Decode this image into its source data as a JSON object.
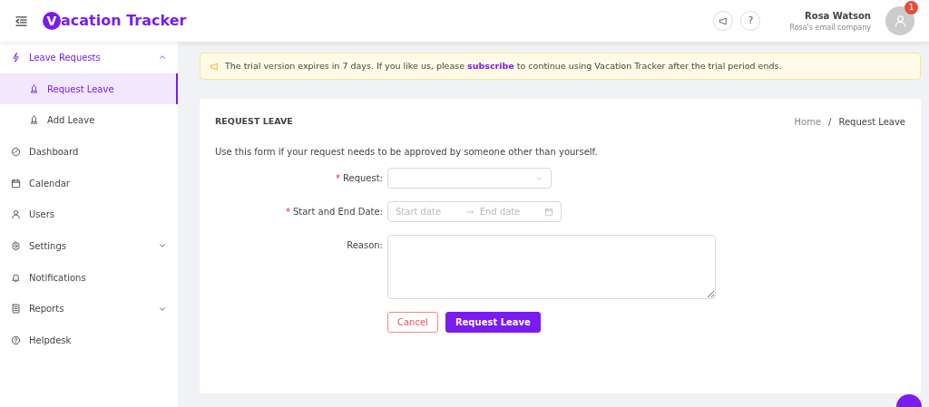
{
  "header": {
    "brand": {
      "mark": "V",
      "text": "acation Tracker"
    },
    "user": {
      "name": "Rosa Watson",
      "company": "Rosa's email company",
      "badge": "1",
      "help": "?"
    }
  },
  "sidebar": {
    "items": [
      {
        "label": "Leave Requests",
        "expanded": true,
        "selected": false,
        "children": [
          {
            "label": "Request Leave",
            "selected": true
          },
          {
            "label": "Add Leave",
            "selected": false
          }
        ]
      },
      {
        "label": "Dashboard",
        "selected": false
      },
      {
        "label": "Calendar",
        "selected": false
      },
      {
        "label": "Users",
        "selected": false
      },
      {
        "label": "Settings",
        "expanded": false,
        "selected": false
      },
      {
        "label": "Notifications",
        "selected": false
      },
      {
        "label": "Reports",
        "expanded": false,
        "selected": false
      },
      {
        "label": "Helpdesk",
        "selected": false
      }
    ]
  },
  "alert": {
    "text": "The trial version expires in 7 days. If you like us, please",
    "link": "subscribe",
    "after": "to continue using Vacation Tracker after the trial period ends."
  },
  "card": {
    "title": "REQUEST LEAVE",
    "breadcrumb": [
      "Home",
      "Request Leave"
    ],
    "breadcrumb_separator": "/",
    "intro": "Use this form if your request needs to be approved by someone other than yourself.",
    "fields": [
      {
        "kind": "select",
        "label": "Request:",
        "required_mark": "*"
      },
      {
        "kind": "daterange",
        "label": "Start and End Date:",
        "required_mark": "*",
        "placeholder": "Start date",
        "placeholder_end": "End date"
      },
      {
        "kind": "textarea",
        "label": "Reason:"
      }
    ],
    "buttons": [
      {
        "label": "Cancel",
        "kind": "outline"
      },
      {
        "label": "Request Leave",
        "kind": "primary"
      }
    ]
  }
}
